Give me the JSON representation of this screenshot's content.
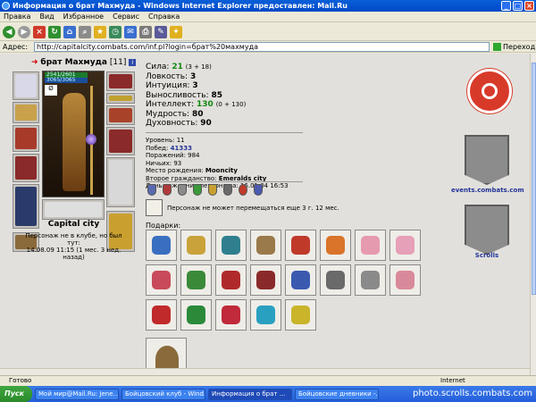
{
  "window": {
    "title": "Информация о брат Махмуда - Windows Internet Explorer предоставлен: Mail.Ru"
  },
  "menu": [
    "Правка",
    "Вид",
    "Избранное",
    "Сервис",
    "Справка"
  ],
  "toolbar": {
    "icons": [
      "back-icon",
      "forward-icon",
      "stop-icon",
      "refresh-icon",
      "home-icon",
      "search-icon",
      "favorites-icon",
      "history-icon",
      "mail-icon",
      "print-icon",
      "edit-icon",
      "messenger-icon"
    ]
  },
  "address": {
    "label": "Адрес:",
    "url": "http://capitalcity.combats.com/inf.pl?login=брат%20махмуда",
    "go_label": "Переход"
  },
  "character": {
    "name": "брат Махмуда",
    "level": "[11]",
    "info_badge": "i",
    "hp": "2541/2601",
    "mp": "3065/3065",
    "city": "Capital city",
    "note": "Персонаж не в клубе, но был тут:\n14.08.09 11:15 (1 мес. 3 нед. назад)"
  },
  "stats": [
    {
      "label": "Сила:",
      "value": "21",
      "extra": "(3 + 18)",
      "green": true
    },
    {
      "label": "Ловкость:",
      "value": "3",
      "extra": "",
      "green": false
    },
    {
      "label": "Интуиция:",
      "value": "3",
      "extra": "",
      "green": false
    },
    {
      "label": "Выносливость:",
      "value": "85",
      "extra": "",
      "green": false
    },
    {
      "label": "Интеллект:",
      "value": "130",
      "extra": "(0 + 130)",
      "green": true
    },
    {
      "label": "Мудрость:",
      "value": "80",
      "extra": "",
      "green": false
    },
    {
      "label": "Духовность:",
      "value": "90",
      "extra": "",
      "green": false
    }
  ],
  "info": {
    "level": "Уровень: 11",
    "wins_label": "Побед:",
    "wins": "41333",
    "losses": "Поражений: 984",
    "draws": "Ничьих: 93",
    "birthplace_label": "Место рождения:",
    "birthplace": "Mooncity",
    "second_label": "Второе гражданство:",
    "second": "Emeralds city",
    "birthday": "День рождения персонажа: 16.01.04 16:53"
  },
  "movement_note": "Персонаж не может перемещаться еще 3 г. 12 мес.",
  "gifts_label": "Подарки:",
  "gifts": [
    {
      "name": "gift-banner",
      "color": "#3a6fc0"
    },
    {
      "name": "gift-pyramid",
      "color": "#c9a23a"
    },
    {
      "name": "gift-dragon",
      "color": "#2f7f8f"
    },
    {
      "name": "gift-pickaxe",
      "color": "#9a7a4a"
    },
    {
      "name": "gift-cookie",
      "color": "#c03a2a"
    },
    {
      "name": "gift-scarf",
      "color": "#d9742a"
    },
    {
      "name": "gift-bear-pink",
      "color": "#e69ab0"
    },
    {
      "name": "gift-bear-pink-2",
      "color": "#e6a0b8"
    },
    {
      "name": "gift-bear-red",
      "color": "#c94a5a"
    },
    {
      "name": "gift-tree",
      "color": "#3a8a3a"
    },
    {
      "name": "gift-ball-red",
      "color": "#b02a2a"
    },
    {
      "name": "gift-vase",
      "color": "#8a2a2a"
    },
    {
      "name": "gift-scroll",
      "color": "#3a5ab0"
    },
    {
      "name": "gift-chest",
      "color": "#6a6a6a"
    },
    {
      "name": "gift-candle",
      "color": "#8a8a8a"
    },
    {
      "name": "gift-bear-heart",
      "color": "#d98a9a"
    },
    {
      "name": "gift-santa",
      "color": "#c02a2a"
    },
    {
      "name": "gift-bell",
      "color": "#2a8a3a"
    },
    {
      "name": "gift-socks",
      "color": "#c02a3a"
    },
    {
      "name": "gift-pillow",
      "color": "#2aa0c0"
    },
    {
      "name": "gift-box",
      "color": "#c9b42a"
    }
  ],
  "clans": {
    "events_label": "events.combats.com",
    "scrolls_label": "Scrolls"
  },
  "status": {
    "ready": "Готово",
    "zone": "Internet"
  },
  "taskbar": {
    "start": "Пуск",
    "tasks": [
      "Мой мир@Mail.Ru: Jene...",
      "Бойцовский клуб - Wind...",
      "Информация о брат ...",
      "Бойцовские дневники -..."
    ],
    "watermark": "photo.scrolls.combats.com"
  }
}
